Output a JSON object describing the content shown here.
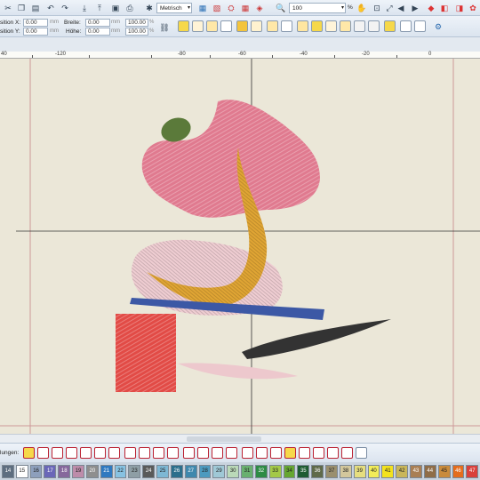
{
  "toolbar1": {
    "units_value": "Metrisch",
    "zoom_value": "100",
    "zoom_unit": "%"
  },
  "toolbar2": {
    "pos_x_label": "sition X:",
    "pos_x_value": "0.00",
    "pos_x_unit": "mm",
    "pos_y_label": "sition Y:",
    "pos_y_value": "0.00",
    "pos_y_unit": "mm",
    "width_label": "Breite:",
    "width_value": "0.00",
    "width_unit": "mm",
    "height_label": "Höhe:",
    "height_value": "0.00",
    "height_unit": "mm",
    "scale_w_value": "100.00",
    "scale_h_value": "100.00",
    "scale_unit": "%"
  },
  "ruler": {
    "labels": [
      "40",
      "-120",
      "-80",
      "-60",
      "-40",
      "-20",
      "0"
    ]
  },
  "stitch_bar": {
    "label": "lungen:"
  },
  "palette": {
    "numbers": [
      "14",
      "15",
      "16",
      "17",
      "18",
      "19",
      "20",
      "21",
      "22",
      "23",
      "24",
      "25",
      "26",
      "27",
      "28",
      "29",
      "30",
      "31",
      "32",
      "33",
      "34",
      "35",
      "36",
      "37",
      "38",
      "39",
      "40",
      "41",
      "42",
      "43",
      "44",
      "45",
      "46",
      "47"
    ],
    "colors": [
      "#5e6e80",
      "#ffffff",
      "#8d9fbc",
      "#6a67b8",
      "#86689c",
      "#bd8caa",
      "#8e8e8e",
      "#2f79c0",
      "#87c2e2",
      "#8e9ea5",
      "#5a5a5a",
      "#7db7d4",
      "#2c6f8c",
      "#3f88ad",
      "#4c9abf",
      "#9fc8d6",
      "#bad9b8",
      "#69b06f",
      "#2e8b45",
      "#a3c948",
      "#66a631",
      "#1f5c32",
      "#5f6a4a",
      "#9a8f6e",
      "#d3c79c",
      "#e6de7f",
      "#f2ec58",
      "#f3e21d",
      "#c9b65a",
      "#a97f54",
      "#8f6d48",
      "#c98b3c",
      "#e46c1c",
      "#d9403b"
    ]
  }
}
